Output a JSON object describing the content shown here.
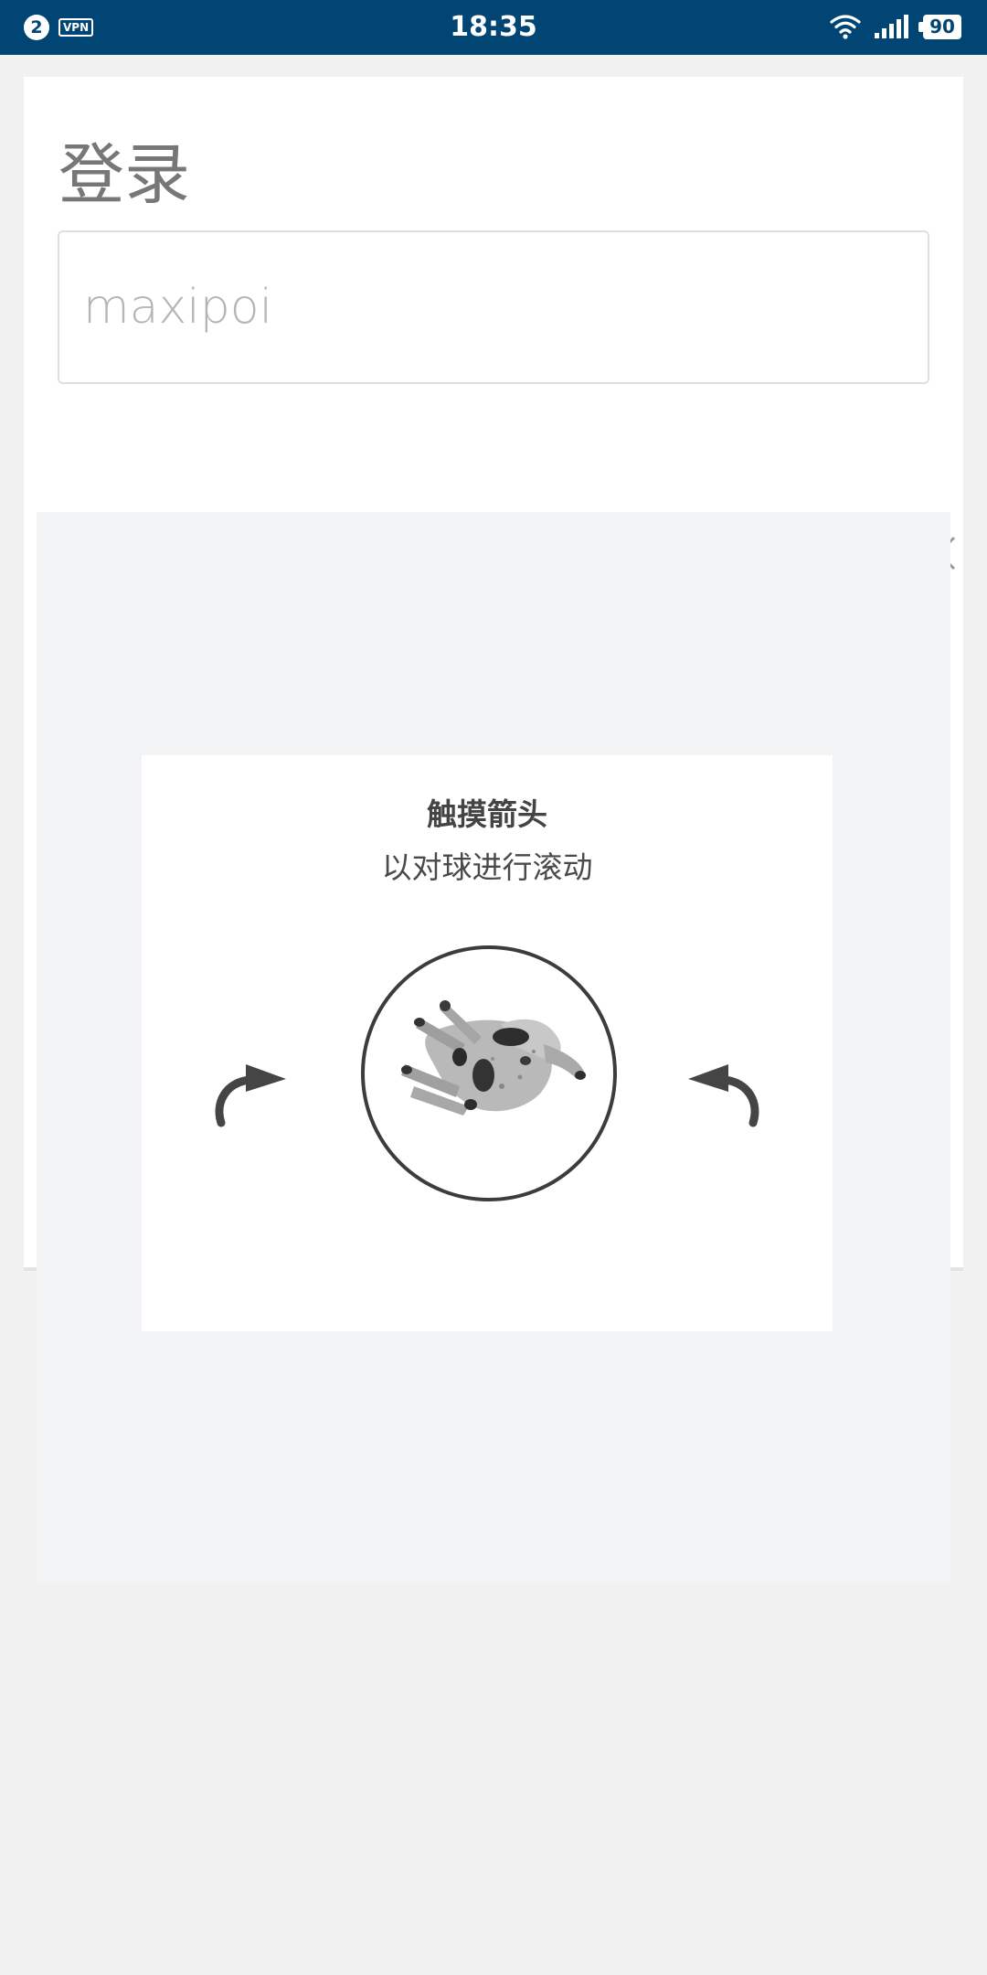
{
  "status_bar": {
    "notification_count": "2",
    "vpn_label": "VPN",
    "time": "18:35",
    "battery_level": "90",
    "icons": [
      "wifi-icon",
      "signal-icon",
      "battery-icon"
    ],
    "background_color": "#004573"
  },
  "login": {
    "title": "登录",
    "username_value": "maxipoi"
  },
  "captcha": {
    "title": "触摸箭头",
    "subtitle": "以对球进行滚动",
    "icons": [
      "close-icon",
      "rotate-left-arrow-icon",
      "rotate-right-arrow-icon",
      "animal-image"
    ]
  }
}
